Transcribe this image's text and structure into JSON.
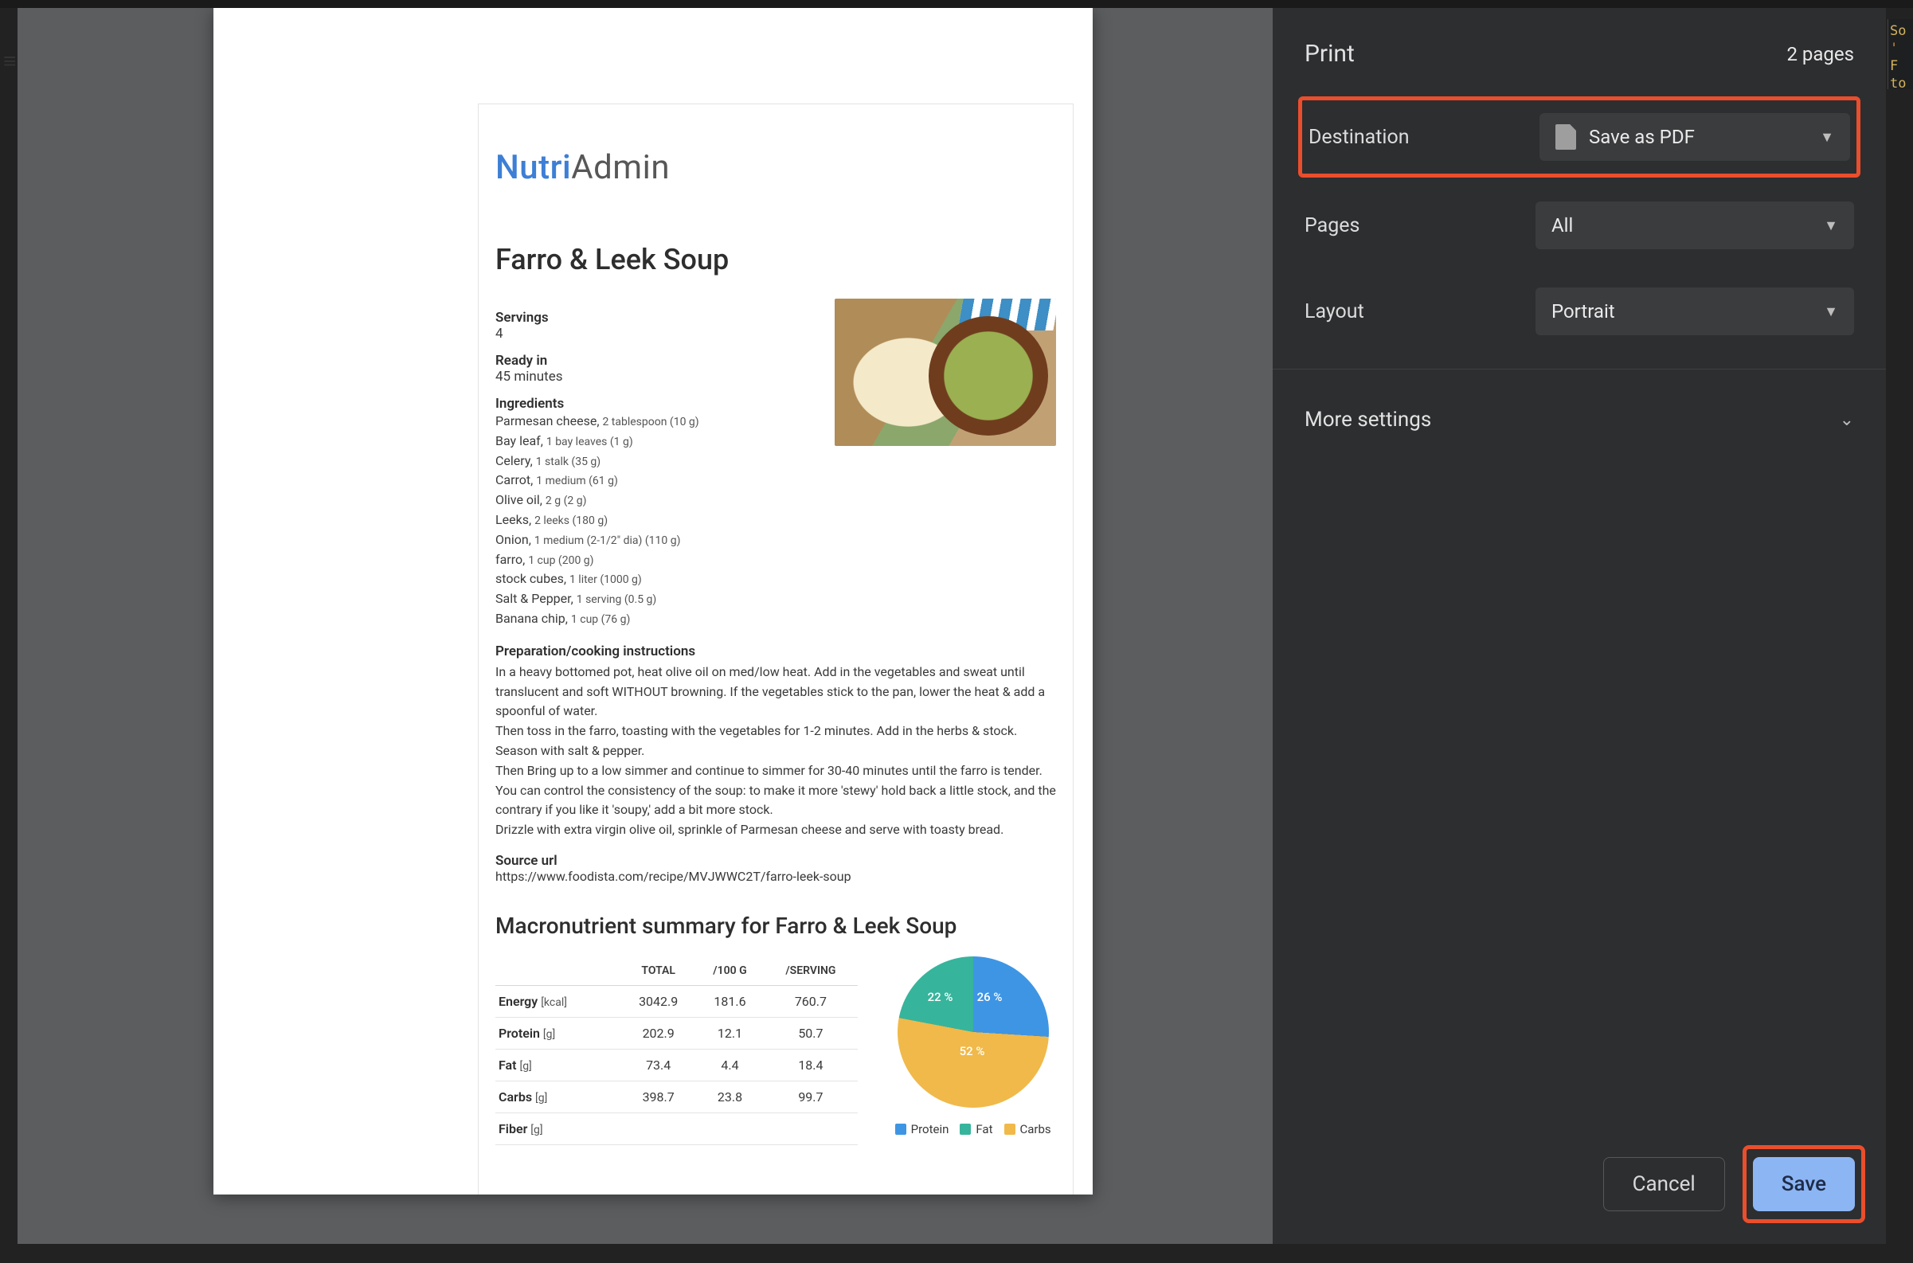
{
  "hamburger_glyph": "≡",
  "logo": {
    "brand1": "Nutri",
    "brand2": "Admin"
  },
  "recipe": {
    "title": "Farro & Leek Soup",
    "servings_label": "Servings",
    "servings_value": "4",
    "ready_label": "Ready in",
    "ready_value": "45 minutes",
    "ingredients_label": "Ingredients",
    "ingredients": [
      {
        "name": "Parmesan cheese,",
        "amt": "2 tablespoon (10 g)"
      },
      {
        "name": "Bay leaf,",
        "amt": "1 bay leaves (1 g)"
      },
      {
        "name": "Celery,",
        "amt": "1 stalk (35 g)"
      },
      {
        "name": "Carrot,",
        "amt": "1 medium (61 g)"
      },
      {
        "name": "Olive oil,",
        "amt": "2 g (2 g)"
      },
      {
        "name": "Leeks,",
        "amt": "2 leeks (180 g)"
      },
      {
        "name": "Onion,",
        "amt": "1 medium (2-1/2\" dia) (110 g)"
      },
      {
        "name": "farro,",
        "amt": "1 cup (200 g)"
      },
      {
        "name": "stock cubes,",
        "amt": "1 liter (1000 g)"
      },
      {
        "name": "Salt & Pepper,",
        "amt": "1 serving (0.5 g)"
      },
      {
        "name": "Banana chip,",
        "amt": "1 cup (76 g)"
      }
    ],
    "instructions_label": "Preparation/cooking instructions",
    "instructions_text": "In a heavy bottomed pot, heat olive oil on med/low heat. Add in the vegetables and sweat until translucent and soft WITHOUT browning. If the vegetables stick to the pan, lower the heat & add a spoonful of water.\nThen toss in the farro, toasting with the vegetables for 1-2 minutes. Add in the herbs & stock. Season with salt & pepper.\nThen Bring up to a low simmer and continue to simmer for 30-40 minutes until the farro is tender.\nYou can control the consistency of the soup: to make it more 'stewy' hold back a little stock, and the contrary if you like it 'soupy,' add a bit more stock.\nDrizzle with extra virgin olive oil, sprinkle of Parmesan cheese and serve with toasty bread.",
    "source_label": "Source url",
    "source_url": "https://www.foodista.com/recipe/MVJWWC2T/farro-leek-soup",
    "macro_title": "Macronutrient summary for Farro & Leek Soup"
  },
  "macro_table": {
    "headers": [
      "",
      "TOTAL",
      "/100 G",
      "/SERVING"
    ],
    "rows": [
      {
        "label": "Energy",
        "unit": "[kcal]",
        "total": "3042.9",
        "per100g": "181.6",
        "perserv": "760.7"
      },
      {
        "label": "Protein",
        "unit": "[g]",
        "total": "202.9",
        "per100g": "12.1",
        "perserv": "50.7"
      },
      {
        "label": "Fat",
        "unit": "[g]",
        "total": "73.4",
        "per100g": "4.4",
        "perserv": "18.4"
      },
      {
        "label": "Carbs",
        "unit": "[g]",
        "total": "398.7",
        "per100g": "23.8",
        "perserv": "99.7"
      },
      {
        "label": "Fiber",
        "unit": "[g]",
        "total": "",
        "per100g": "",
        "perserv": ""
      }
    ]
  },
  "chart_data": {
    "type": "pie",
    "title": "",
    "series": [
      {
        "name": "Protein",
        "value": 26,
        "label": "26 %",
        "color": "#3e95e4"
      },
      {
        "name": "Fat",
        "value": 22,
        "label": "22 %",
        "color": "#37b49c"
      },
      {
        "name": "Carbs",
        "value": 52,
        "label": "52 %",
        "color": "#f0b94a"
      }
    ],
    "legend": [
      "Protein",
      "Fat",
      "Carbs"
    ]
  },
  "print_panel": {
    "title": "Print",
    "page_count": "2 pages",
    "destination_label": "Destination",
    "destination_value": "Save as PDF",
    "pages_label": "Pages",
    "pages_value": "All",
    "layout_label": "Layout",
    "layout_value": "Portrait",
    "more_settings_label": "More settings",
    "cancel_label": "Cancel",
    "save_label": "Save"
  },
  "code_sliver": {
    "l1": "So",
    "l2": "'",
    "l3": "F",
    "l4": "to"
  }
}
